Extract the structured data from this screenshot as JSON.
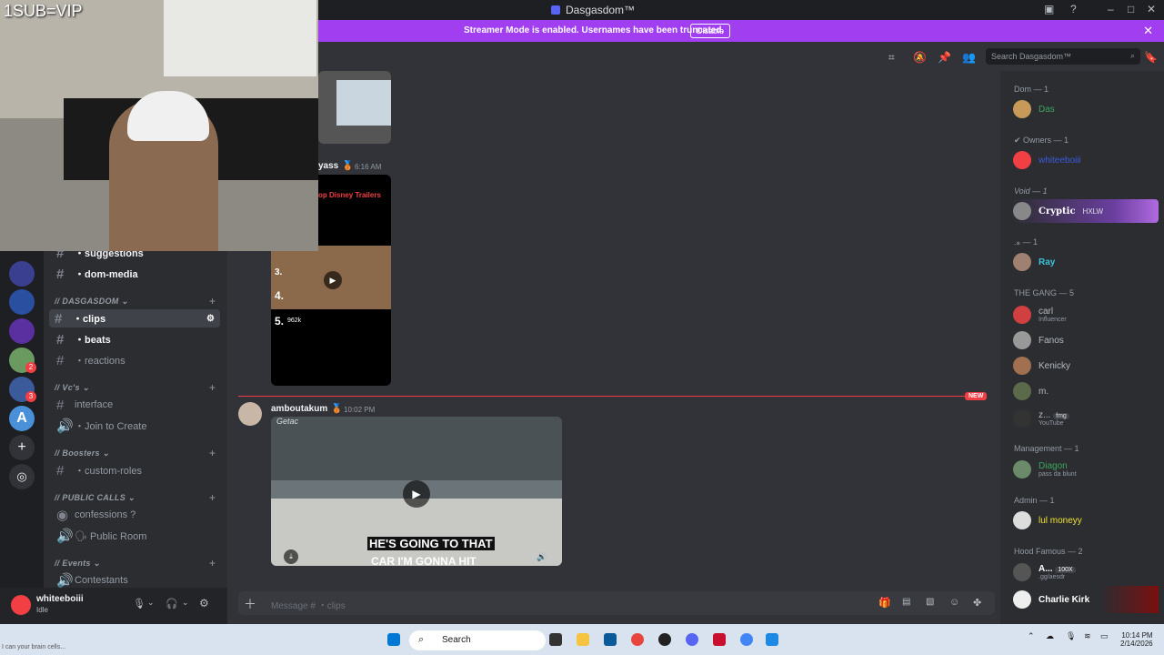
{
  "titlebar": {
    "title": "Dasgasdom™"
  },
  "banner": {
    "message": "Streamer Mode is enabled. Usernames have been truncated.",
    "button": "Disable"
  },
  "webcam": {
    "label": "1SUB=VIP"
  },
  "header": {
    "search_placeholder": "Search Dasgasdom™"
  },
  "channels": {
    "items": [
      {
        "name": "・suggestions"
      },
      {
        "name": "・dom-media"
      },
      {
        "name": "・clips"
      },
      {
        "name": "・beats"
      },
      {
        "name": "・reactions"
      },
      {
        "name": "interface"
      },
      {
        "name": "・Join to Create"
      },
      {
        "name": "・custom-roles"
      },
      {
        "name": "confessions ?"
      },
      {
        "name": "🗣 Public Room"
      },
      {
        "name": "Contestants"
      }
    ],
    "categories": [
      {
        "name": "// DASGASDOM"
      },
      {
        "name": "// Vc's"
      },
      {
        "name": "// Boosters"
      },
      {
        "name": "// PUBLIC CALLS"
      },
      {
        "name": "// Events"
      }
    ]
  },
  "servers": {
    "badges": [
      "2",
      "3"
    ]
  },
  "user": {
    "name": "whiteeboiii",
    "status": "Idle"
  },
  "messages": [
    {
      "author": "yass",
      "time": "6:16 AM",
      "embed_text": "op Disney Trailers",
      "list": [
        "3.",
        "4.",
        "5."
      ],
      "views": "962k"
    },
    {
      "author": "amboutakum",
      "time": "10:02 PM",
      "embed_caption_1": "HE'S GOING TO THAT",
      "embed_caption_2": "CAR I'M GONNA HIT",
      "embed_brand": "Getac"
    }
  ],
  "new_divider": "NEW",
  "composer": {
    "placeholder": "Message # ・clips"
  },
  "members": {
    "groups": [
      {
        "role": "Dom — 1",
        "members": [
          {
            "name": "Das",
            "color": "#3ba55d",
            "sub": ""
          }
        ]
      },
      {
        "role": "Owners — 1",
        "members": [
          {
            "name": "whiteeboiii",
            "color": "#3b5bdb",
            "sub": ""
          }
        ]
      },
      {
        "role": "Void — 1",
        "members": [
          {
            "name": "Cryptic",
            "color": "#ffffff",
            "sub": "",
            "tag": "HXLW"
          }
        ]
      },
      {
        "role": ".⁎ — 1",
        "members": [
          {
            "name": "Ray",
            "color": "#3bc4d6",
            "sub": ""
          }
        ]
      },
      {
        "role": "THE GANG — 5",
        "members": [
          {
            "name": "carl",
            "color": "#b5bac1",
            "sub": "Influencer"
          },
          {
            "name": "Fanos",
            "color": "#b5bac1",
            "sub": ""
          },
          {
            "name": "Kenicky",
            "color": "#b5bac1",
            "sub": ""
          },
          {
            "name": "m.",
            "color": "#b5bac1",
            "sub": ""
          },
          {
            "name": "z...",
            "color": "#b5bac1",
            "sub": "YouTube",
            "tag": "fmg"
          }
        ]
      },
      {
        "role": "Management — 1",
        "members": [
          {
            "name": "Diagon",
            "color": "#3ba55d",
            "sub": "pass da blunt"
          }
        ]
      },
      {
        "role": "Admin — 1",
        "members": [
          {
            "name": "lul moneyy",
            "color": "#f0e130",
            "sub": ""
          }
        ]
      },
      {
        "role": "Hood Famous — 2",
        "members": [
          {
            "name": "A...",
            "color": "#ffffff",
            "sub": ".gg/aesdr",
            "tag": "100X"
          },
          {
            "name": "Charlie Kirk",
            "color": "#ffffff",
            "sub": ""
          }
        ]
      }
    ]
  },
  "taskbar": {
    "search": "Search",
    "time": "10:14 PM",
    "date": "2/14/2026",
    "status_text": "I can your brain cells..."
  }
}
